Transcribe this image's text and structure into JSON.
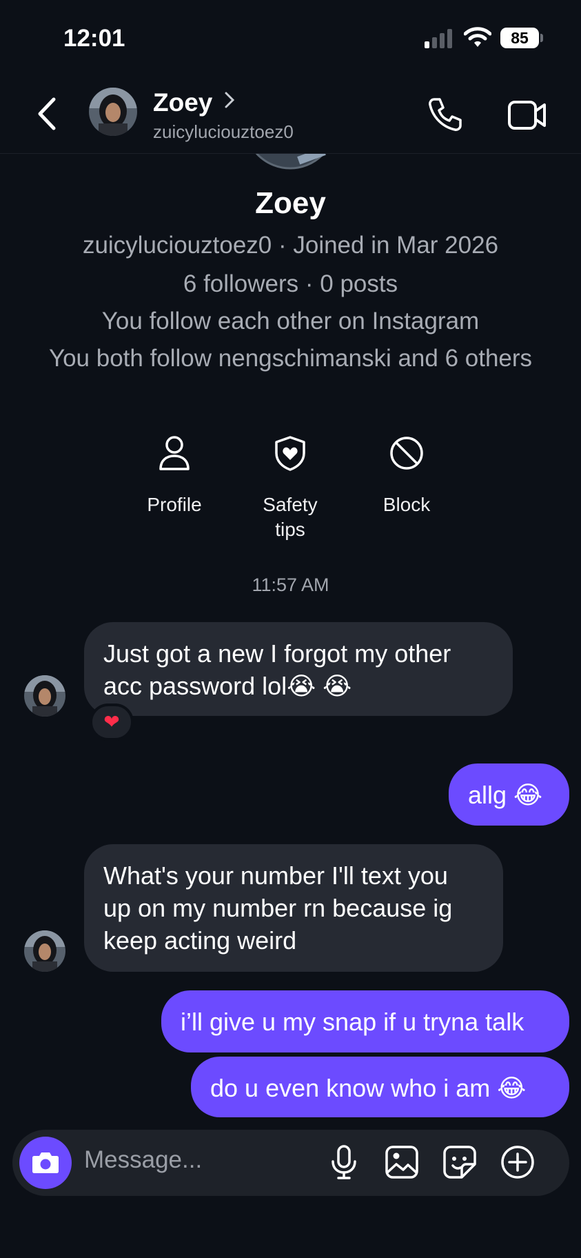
{
  "status": {
    "time": "12:01",
    "battery": "85"
  },
  "header": {
    "name": "Zoey",
    "username": "zuicyluciouztoez0"
  },
  "profile": {
    "name": "Zoey",
    "line1": "zuicyluciouztoez0 · Joined in Mar 2026",
    "line2": "6 followers · 0 posts",
    "line3": "You follow each other on Instagram",
    "line4": "You both follow nengschimanski and 6 others",
    "actions": {
      "profile": "Profile",
      "safety": "Safety\ntips",
      "block": "Block"
    }
  },
  "thread": {
    "timestamp": "11:57 AM",
    "messages": [
      {
        "from": "them",
        "text": "Just got a new  I forgot my other\nacc password lol😭 😭",
        "reaction": "❤"
      },
      {
        "from": "me",
        "text": "allg 😂"
      },
      {
        "from": "them",
        "text": "What's your number I'll text you\nup on my number rn because ig\nkeep acting weird"
      },
      {
        "from": "me",
        "text": "i’ll give u my snap if u tryna talk"
      },
      {
        "from": "me",
        "text": "do u even know who i am 😂"
      }
    ]
  },
  "composer": {
    "placeholder": "Message..."
  },
  "colors": {
    "background": "#0c1017",
    "accent": "#6c4bff",
    "incoming_bubble": "#262a33"
  },
  "icons": [
    "back-arrow-icon",
    "chevron-right-icon",
    "phone-icon",
    "video-camera-icon",
    "person-icon",
    "shield-heart-icon",
    "block-icon",
    "camera-icon",
    "microphone-icon",
    "image-icon",
    "sticker-icon",
    "plus-circle-icon"
  ]
}
